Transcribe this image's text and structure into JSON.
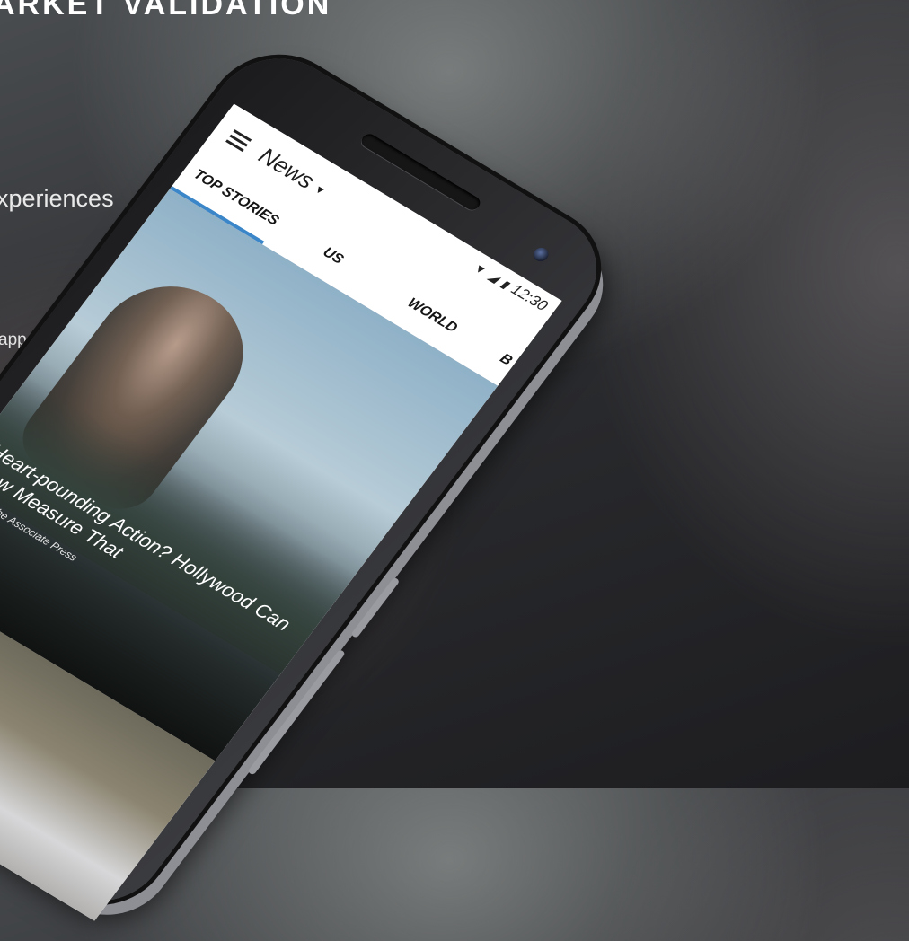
{
  "slide": {
    "headline": "ARKET VALIDATION",
    "line1": "xperiences",
    "line2": "app"
  },
  "phone": {
    "status_time": "12:30",
    "app": {
      "title": "News",
      "tabs": [
        {
          "label": "TOP STORIES",
          "selected": true
        },
        {
          "label": "US",
          "selected": false
        },
        {
          "label": "WORLD",
          "selected": false
        },
        {
          "label": "B",
          "selected": false
        }
      ],
      "hero": {
        "title": "Heart-pounding Action? Hollywood Can Now Measure That",
        "meta": "Read  ·  The Associate Press"
      }
    },
    "colors": {
      "tab_underline": "#3a86c8"
    }
  }
}
